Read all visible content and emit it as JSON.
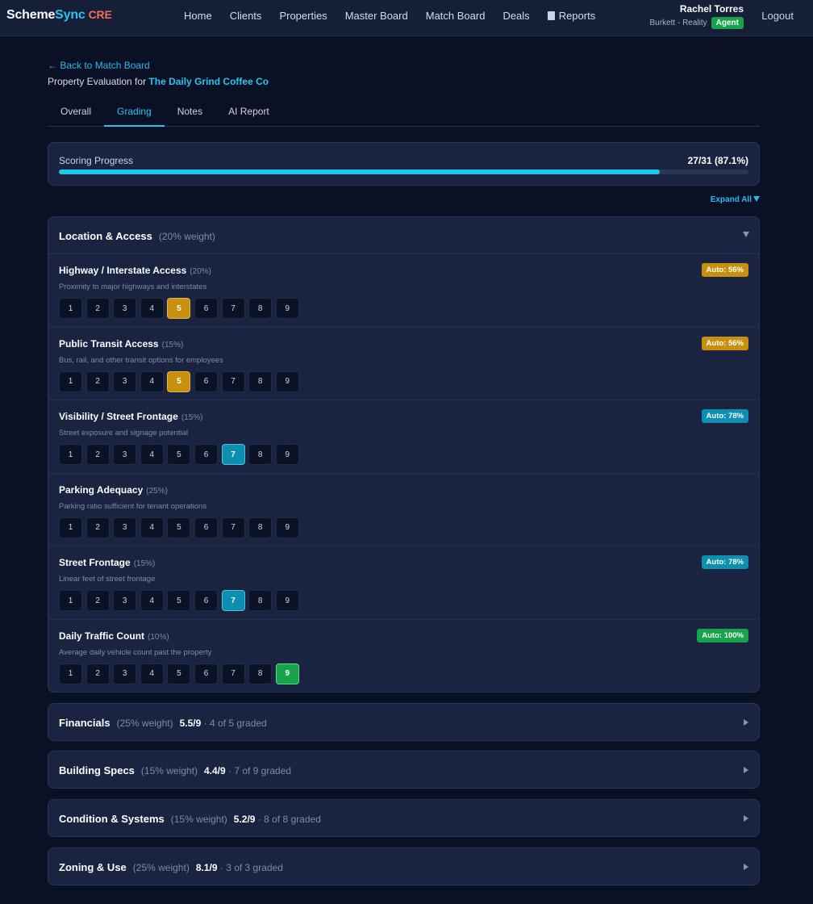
{
  "brand": {
    "part1": "Scheme",
    "part2": "Sync",
    "part3": "CRE"
  },
  "nav": {
    "items": [
      "Home",
      "Clients",
      "Properties",
      "Master Board",
      "Match Board",
      "Deals"
    ],
    "reports": "Reports",
    "user_name": "Rachel Torres",
    "user_org": "Burkett - Reality",
    "role": "Agent",
    "logout": "Logout"
  },
  "header": {
    "back": "← Back to Match Board",
    "eval_prefix": "Property Evaluation for",
    "client": "The Daily Grind Coffee Co"
  },
  "tabs": [
    "Overall",
    "Grading",
    "Notes",
    "AI Report"
  ],
  "active_tab": "Grading",
  "progress": {
    "label": "Scoring Progress",
    "value_text": "27/31 (87.1%)",
    "fraction": 0.871,
    "color": "#22c7ee"
  },
  "expand_all": "Expand All",
  "open_section": {
    "title": "Location & Access",
    "weight": "(20% weight)",
    "criteria": [
      {
        "title": "Highway / Interstate Access",
        "weight": "(20%)",
        "desc": "Proximity to major highways and interstates",
        "badge": "Auto: 56%",
        "badge_color": "#c8900f",
        "selected": 5,
        "sel_color": "#c8900f",
        "sel_border": "#e8b54a"
      },
      {
        "title": "Public Transit Access",
        "weight": "(15%)",
        "desc": "Bus, rail, and other transit options for employees",
        "badge": "Auto: 56%",
        "badge_color": "#c8900f",
        "selected": 5,
        "sel_color": "#c8900f",
        "sel_border": "#e8b54a"
      },
      {
        "title": "Visibility / Street Frontage",
        "weight": "(15%)",
        "desc": "Street exposure and signage potential",
        "badge": "Auto: 78%",
        "badge_color": "#0e8fb0",
        "selected": 7,
        "sel_color": "#0e8fb0",
        "sel_border": "#46c2de"
      },
      {
        "title": "Parking Adequacy",
        "weight": "(25%)",
        "desc": "Parking ratio sufficient for tenant operations",
        "badge": "",
        "badge_color": "",
        "selected": 0,
        "sel_color": "",
        "sel_border": ""
      },
      {
        "title": "Street Frontage",
        "weight": "(15%)",
        "desc": "Linear feet of street frontage",
        "badge": "Auto: 78%",
        "badge_color": "#0e8fb0",
        "selected": 7,
        "sel_color": "#0e8fb0",
        "sel_border": "#46c2de"
      },
      {
        "title": "Daily Traffic Count",
        "weight": "(10%)",
        "desc": "Average daily vehicle count past the property",
        "badge": "Auto: 100%",
        "badge_color": "#16a34a",
        "selected": 9,
        "sel_color": "#16a34a",
        "sel_border": "#5fd889"
      }
    ]
  },
  "scale": [
    "1",
    "2",
    "3",
    "4",
    "5",
    "6",
    "7",
    "8",
    "9"
  ],
  "sections": [
    {
      "title": "Financials",
      "weight": "(25% weight)",
      "score": "5.5/9",
      "graded": "· 4 of 5 graded"
    },
    {
      "title": "Building Specs",
      "weight": "(15% weight)",
      "score": "4.4/9",
      "graded": "· 7 of 9 graded"
    },
    {
      "title": "Condition & Systems",
      "weight": "(15% weight)",
      "score": "5.2/9",
      "graded": "· 8 of 8 graded"
    },
    {
      "title": "Zoning & Use",
      "weight": "(25% weight)",
      "score": "8.1/9",
      "graded": "· 3 of 3 graded"
    }
  ]
}
